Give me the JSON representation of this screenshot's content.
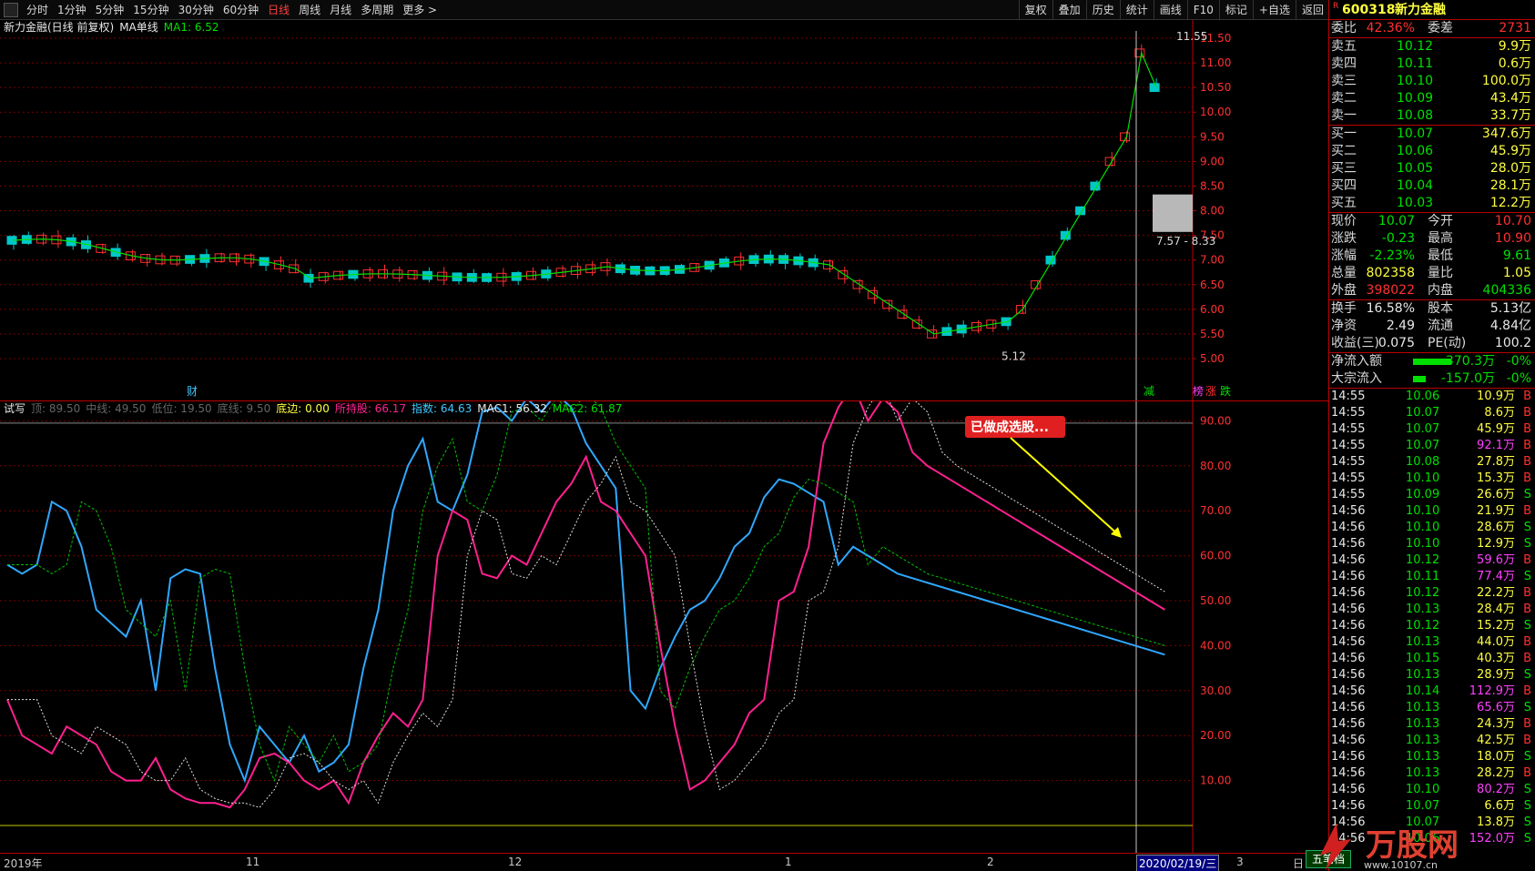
{
  "toolbar": {
    "periods": [
      "分时",
      "1分钟",
      "5分钟",
      "15分钟",
      "30分钟",
      "60分钟",
      "日线",
      "周线",
      "月线",
      "多周期",
      "更多 >"
    ],
    "active_period": "日线",
    "right_tools": [
      "复权",
      "叠加",
      "历史",
      "统计",
      "画线",
      "F10",
      "标记",
      "+自选",
      "返回"
    ]
  },
  "kline": {
    "title": "新力金融(日线 前复权)",
    "ma_label": "MA单线",
    "ma1": "MA1: 6.52",
    "price_ticks": [
      "11.50",
      "11.00",
      "10.50",
      "10.00",
      "9.50",
      "9.00",
      "8.50",
      "8.00",
      "7.50",
      "7.00",
      "6.50",
      "6.00",
      "5.50",
      "5.00"
    ],
    "high_label": "11.55",
    "low_label": "5.12",
    "zone_label": "7.57 - 8.33",
    "markers": {
      "cai": "财",
      "jian": "减",
      "bang": "榜",
      "zhang": "涨",
      "die": "跌"
    },
    "colors": {
      "up": "#ff3030",
      "down": "#00c8c8",
      "ma": "#00e000",
      "grid": "#8b0000"
    }
  },
  "oscillator": {
    "name": "试写",
    "ding": "顶: 89.50",
    "zhongxian": "中线: 49.50",
    "diwei": "低位: 19.50",
    "dixian": "底线: 9.50",
    "dibian": "底边: 0.00",
    "suochigu": "所持股: 66.17",
    "zhishu": "指数: 64.63",
    "mac1": "MAC1: 56.32",
    "mac2": "MAC2: 61.87",
    "ticks": [
      "90.00",
      "80.00",
      "70.00",
      "60.00",
      "50.00",
      "40.00",
      "30.00",
      "20.00",
      "10.00"
    ],
    "annotation": "已做成选股..."
  },
  "xaxis": {
    "labels": [
      "2019年",
      "11",
      "12",
      "1",
      "2",
      "2020/02/19/三",
      "3"
    ],
    "right_label": "日"
  },
  "quote": {
    "code": "600318",
    "name": "新力金融",
    "weibi_label": "委比",
    "weibi": "42.36%",
    "weicha_label": "委差",
    "weicha": "2731",
    "asks": [
      {
        "label": "卖五",
        "price": "10.12",
        "vol": "9.9万"
      },
      {
        "label": "卖四",
        "price": "10.11",
        "vol": "0.6万"
      },
      {
        "label": "卖三",
        "price": "10.10",
        "vol": "100.0万"
      },
      {
        "label": "卖二",
        "price": "10.09",
        "vol": "43.4万"
      },
      {
        "label": "卖一",
        "price": "10.08",
        "vol": "33.7万"
      }
    ],
    "bids": [
      {
        "label": "买一",
        "price": "10.07",
        "vol": "347.6万"
      },
      {
        "label": "买二",
        "price": "10.06",
        "vol": "45.9万"
      },
      {
        "label": "买三",
        "price": "10.05",
        "vol": "28.0万"
      },
      {
        "label": "买四",
        "price": "10.04",
        "vol": "28.1万"
      },
      {
        "label": "买五",
        "price": "10.03",
        "vol": "12.2万"
      }
    ],
    "stats": [
      {
        "l1": "现价",
        "v1": "10.07",
        "l2": "今开",
        "v2": "10.70"
      },
      {
        "l1": "涨跌",
        "v1": "-0.23",
        "l2": "最高",
        "v2": "10.90"
      },
      {
        "l1": "涨幅",
        "v1": "-2.23%",
        "l2": "最低",
        "v2": "9.61"
      },
      {
        "l1": "总量",
        "v1": "802358",
        "l2": "量比",
        "v2": "1.05"
      },
      {
        "l1": "外盘",
        "v1": "398022",
        "l2": "内盘",
        "v2": "404336"
      }
    ],
    "stats2": [
      {
        "l1": "换手",
        "v1": "16.58%",
        "l2": "股本",
        "v2": "5.13亿"
      },
      {
        "l1": "净资",
        "v1": "2.49",
        "l2": "流通",
        "v2": "4.84亿"
      },
      {
        "l1": "收益(三)",
        "v1": "0.075",
        "l2": "PE(动)",
        "v2": "100.2"
      }
    ],
    "flow": [
      {
        "label": "净流入额",
        "value": "-370.3万",
        "pct": "-0%",
        "bar": 0.6
      },
      {
        "label": "大宗流入",
        "value": "-157.0万",
        "pct": "-0%",
        "bar": 0.2
      }
    ]
  },
  "ticks": [
    {
      "t": "14:55",
      "p": "10.06",
      "v": "10.9万",
      "d": "B"
    },
    {
      "t": "14:55",
      "p": "10.07",
      "v": "8.6万",
      "d": "B"
    },
    {
      "t": "14:55",
      "p": "10.07",
      "v": "45.9万",
      "d": "B"
    },
    {
      "t": "14:55",
      "p": "10.07",
      "v": "92.1万",
      "d": "B"
    },
    {
      "t": "14:55",
      "p": "10.08",
      "v": "27.8万",
      "d": "B"
    },
    {
      "t": "14:55",
      "p": "10.10",
      "v": "15.3万",
      "d": "B"
    },
    {
      "t": "14:55",
      "p": "10.09",
      "v": "26.6万",
      "d": "S"
    },
    {
      "t": "14:56",
      "p": "10.10",
      "v": "21.9万",
      "d": "B"
    },
    {
      "t": "14:56",
      "p": "10.10",
      "v": "28.6万",
      "d": "S"
    },
    {
      "t": "14:56",
      "p": "10.10",
      "v": "12.9万",
      "d": "S"
    },
    {
      "t": "14:56",
      "p": "10.12",
      "v": "59.6万",
      "d": "B"
    },
    {
      "t": "14:56",
      "p": "10.11",
      "v": "77.4万",
      "d": "S"
    },
    {
      "t": "14:56",
      "p": "10.12",
      "v": "22.2万",
      "d": "B"
    },
    {
      "t": "14:56",
      "p": "10.13",
      "v": "28.4万",
      "d": "B"
    },
    {
      "t": "14:56",
      "p": "10.12",
      "v": "15.2万",
      "d": "S"
    },
    {
      "t": "14:56",
      "p": "10.13",
      "v": "44.0万",
      "d": "B"
    },
    {
      "t": "14:56",
      "p": "10.15",
      "v": "40.3万",
      "d": "B"
    },
    {
      "t": "14:56",
      "p": "10.13",
      "v": "28.9万",
      "d": "S"
    },
    {
      "t": "14:56",
      "p": "10.14",
      "v": "112.9万",
      "d": "B"
    },
    {
      "t": "14:56",
      "p": "10.13",
      "v": "65.6万",
      "d": "S"
    },
    {
      "t": "14:56",
      "p": "10.13",
      "v": "24.3万",
      "d": "B"
    },
    {
      "t": "14:56",
      "p": "10.13",
      "v": "42.5万",
      "d": "B"
    },
    {
      "t": "14:56",
      "p": "10.13",
      "v": "18.0万",
      "d": "S"
    },
    {
      "t": "14:56",
      "p": "10.13",
      "v": "28.2万",
      "d": "B"
    },
    {
      "t": "14:56",
      "p": "10.10",
      "v": "80.2万",
      "d": "S"
    },
    {
      "t": "14:56",
      "p": "10.07",
      "v": "6.6万",
      "d": "S"
    },
    {
      "t": "14:56",
      "p": "10.07",
      "v": "13.8万",
      "d": "S"
    },
    {
      "t": "14:56",
      "p": "10.06",
      "v": "152.0万",
      "d": "S"
    }
  ],
  "bottom_tab": "五笔档",
  "watermark": {
    "brand": "万股网",
    "url": "www.10107.cn"
  }
}
